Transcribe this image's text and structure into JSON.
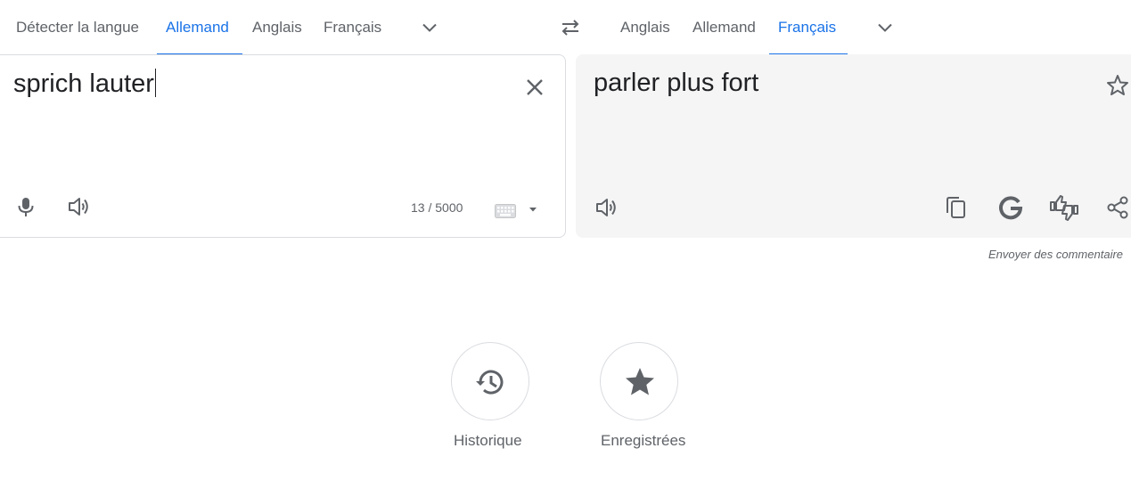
{
  "source_languages": {
    "tabs": [
      "Détecter la langue",
      "Allemand",
      "Anglais",
      "Français"
    ],
    "active": "Allemand"
  },
  "target_languages": {
    "tabs": [
      "Anglais",
      "Allemand",
      "Français"
    ],
    "active": "Français"
  },
  "source": {
    "text": "sprich lauter",
    "char_count": "13 / 5000"
  },
  "target": {
    "text": "parler plus fort",
    "feedback_link": "Envoyer des commentaire"
  },
  "bottom": {
    "history_label": "Historique",
    "saved_label": "Enregistrées"
  },
  "colors": {
    "accent": "#1a73e8",
    "target_bg": "#f5f5f5",
    "icon": "#5f6368"
  },
  "icons": {
    "swap": "swap-icon",
    "chevron": "chevron-down-icon",
    "clear": "close-icon",
    "mic": "microphone-icon",
    "speaker": "speaker-icon",
    "keyboard": "keyboard-icon",
    "star": "star-outline-icon",
    "copy": "copy-icon",
    "google": "google-g-icon",
    "rate": "thumbs-rate-icon",
    "share": "share-icon",
    "history": "history-icon",
    "saved": "star-filled-icon"
  }
}
